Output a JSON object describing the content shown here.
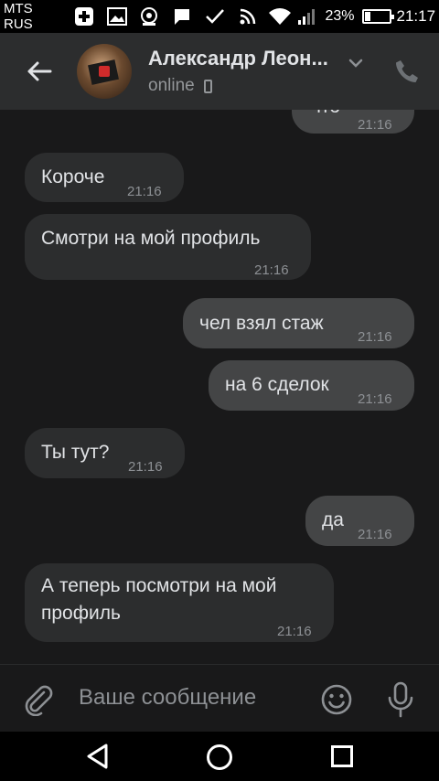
{
  "status_bar": {
    "carrier": "MTS RUS",
    "battery_percent": "23%",
    "battery_level": 0.23,
    "time": "21:17"
  },
  "header": {
    "contact_name": "Александр Леон...",
    "status": "online"
  },
  "messages": [
    {
      "text": "что",
      "time": "21:16",
      "direction": "out"
    },
    {
      "text": "Короче",
      "time": "21:16",
      "direction": "in"
    },
    {
      "text": "Смотри на мой профиль",
      "time": "21:16",
      "direction": "in"
    },
    {
      "text": "чел взял стаж",
      "time": "21:16",
      "direction": "out"
    },
    {
      "text": "на 6 сделок",
      "time": "21:16",
      "direction": "out"
    },
    {
      "text": "Ты тут?",
      "time": "21:16",
      "direction": "in"
    },
    {
      "text": "да",
      "time": "21:16",
      "direction": "out"
    },
    {
      "text": "А теперь посмотри на мой профиль",
      "time": "21:16",
      "direction": "in"
    }
  ],
  "composer": {
    "placeholder": "Ваше сообщение"
  },
  "icons": {
    "back": "arrow-left-icon",
    "call": "phone-icon",
    "attach": "paperclip-icon",
    "emoji": "smile-icon",
    "voice": "microphone-icon"
  },
  "colors": {
    "background": "#19191a",
    "header": "#2c2d2e",
    "incoming_bubble": "#2c2d2e",
    "outgoing_bubble": "#444546",
    "text": "#e1e3e6",
    "secondary": "#8d9094"
  }
}
